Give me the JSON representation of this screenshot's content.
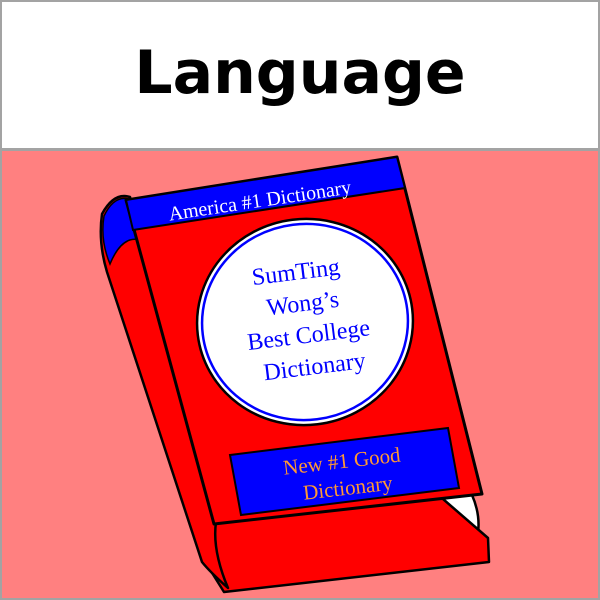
{
  "header": {
    "title": "Language"
  },
  "book": {
    "top_banner": "America #1 Dictionary",
    "seal_lines": [
      "SumTing",
      "Wong’s",
      "Best College",
      "Dictionary"
    ],
    "bottom_banner_lines": [
      "New #1 Good",
      "Dictionary"
    ]
  },
  "colors": {
    "background": "#ff8080",
    "header_background": "#ffffff",
    "book_red": "#ff0000",
    "book_blue": "#0000ff",
    "seal_text": "#0000ff",
    "banner_text_top": "#ffffff",
    "banner_text_bottom": "#ff9933"
  }
}
